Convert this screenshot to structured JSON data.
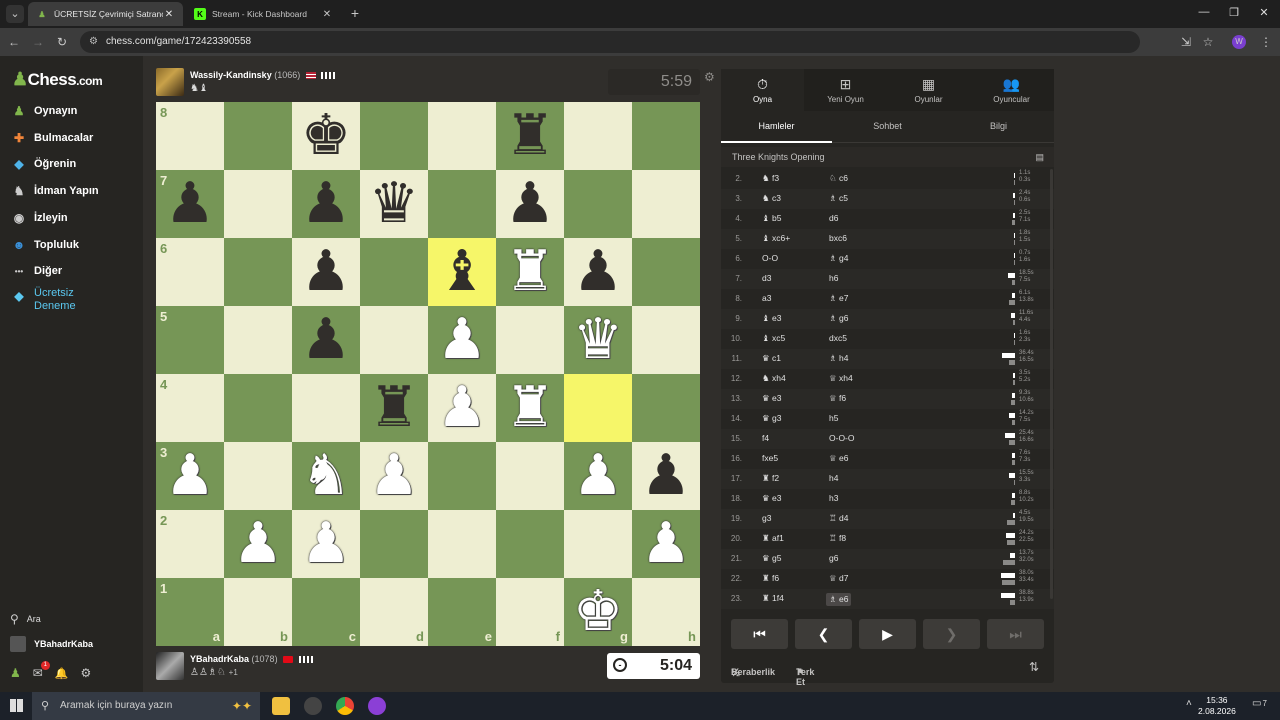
{
  "browser": {
    "tabs": [
      {
        "title": "ÜCRETSİZ Çevrimiçi Satranç Oyu",
        "active": true,
        "icon": "chess-pawn-icon"
      },
      {
        "title": "Stream - Kick Dashboard",
        "active": false,
        "icon": "kick-k-icon"
      }
    ],
    "url": "chess.com/game/172423390558"
  },
  "sidebar": {
    "logo": "Chess",
    "logo_suffix": ".com",
    "items": [
      {
        "label": "Oynayın",
        "icon": "play-pawn-icon",
        "color": "#81b64c"
      },
      {
        "label": "Bulmacalar",
        "icon": "puzzle-icon",
        "color": "#f0853a"
      },
      {
        "label": "Öğrenin",
        "icon": "learn-icon",
        "color": "#4fb3e8"
      },
      {
        "label": "İdman Yapın",
        "icon": "train-icon",
        "color": "#cccccc"
      },
      {
        "label": "İzleyin",
        "icon": "watch-icon",
        "color": "#cccccc"
      },
      {
        "label": "Topluluk",
        "icon": "community-icon",
        "color": "#3a90d8"
      },
      {
        "label": "Diğer",
        "icon": "more-dots-icon",
        "color": "#cccccc"
      },
      {
        "label": "Ücretsiz Deneme",
        "icon": "diamond-icon",
        "color": "#5bc8f0"
      }
    ],
    "search_label": "Ara",
    "username": "YBahadrKaba",
    "notification_count": "1"
  },
  "top_player": {
    "name": "Wassily-Kandinsky",
    "rating": "(1066)",
    "captured": "♞♝",
    "clock": "5:59"
  },
  "bottom_player": {
    "name": "YBahadrKaba",
    "rating": "(1078)",
    "captured": "♙♙♗♘",
    "advantage": "+1",
    "clock": "5:04"
  },
  "board": {
    "files": [
      "a",
      "b",
      "c",
      "d",
      "e",
      "f",
      "g",
      "h"
    ],
    "ranks": [
      "8",
      "7",
      "6",
      "5",
      "4",
      "3",
      "2",
      "1"
    ],
    "highlight": [
      "e6",
      "g4"
    ],
    "pieces": {
      "c8": "bK",
      "f8": "bR",
      "a7": "bP",
      "c7": "bP",
      "d7": "bQ",
      "f7": "bP",
      "c6": "bP",
      "e6": "bB",
      "f6": "wR",
      "g6": "bP",
      "c5": "bP",
      "e5": "wP",
      "g5": "wQ",
      "d4": "bR",
      "e4": "wP",
      "f4": "wR",
      "a3": "wP",
      "c3": "wN",
      "d3": "wP",
      "g3": "wP",
      "h3": "bP",
      "b2": "wP",
      "c2": "wP",
      "h2": "wP",
      "g1": "wK"
    }
  },
  "panel": {
    "tabs": [
      {
        "label": "Oyna",
        "icon": "stopwatch-icon"
      },
      {
        "label": "Yeni Oyun",
        "icon": "plus-icon"
      },
      {
        "label": "Oyunlar",
        "icon": "board-icon"
      },
      {
        "label": "Oyuncular",
        "icon": "players-icon"
      }
    ],
    "subtabs": [
      "Hamleler",
      "Sohbet",
      "Bilgi"
    ],
    "opening": "Three Knights Opening",
    "moves": [
      {
        "n": "2.",
        "w": "♞ f3",
        "b": "♘ c6",
        "wt": "1.1s",
        "bt": "0.3s",
        "wf": 0.1,
        "bf": 0.05
      },
      {
        "n": "3.",
        "w": "♞ c3",
        "b": "♗ c5",
        "wt": "2.4s",
        "bt": "0.6s",
        "wf": 0.12,
        "bf": 0.06
      },
      {
        "n": "4.",
        "w": "♝ b5",
        "b": "d6",
        "wt": "2.5s",
        "bt": "7.1s",
        "wf": 0.12,
        "bf": 0.2
      },
      {
        "n": "5.",
        "w": "♝ xc6+",
        "b": "bxc6",
        "wt": "1.8s",
        "bt": "1.5s",
        "wf": 0.1,
        "bf": 0.08
      },
      {
        "n": "6.",
        "w": "O-O",
        "b": "♗ g4",
        "wt": "0.7s",
        "bt": "1.6s",
        "wf": 0.05,
        "bf": 0.08
      },
      {
        "n": "7.",
        "w": "d3",
        "b": "h6",
        "wt": "18.5s",
        "bt": "7.5s",
        "wf": 0.5,
        "bf": 0.2
      },
      {
        "n": "8.",
        "w": "a3",
        "b": "♗ e7",
        "wt": "6.1s",
        "bt": "13.8s",
        "wf": 0.18,
        "bf": 0.4
      },
      {
        "n": "9.",
        "w": "♝ e3",
        "b": "♗ g6",
        "wt": "11.6s",
        "bt": "4.4s",
        "wf": 0.32,
        "bf": 0.12
      },
      {
        "n": "10.",
        "w": "♝ xc5",
        "b": "dxc5",
        "wt": "1.6s",
        "bt": "2.3s",
        "wf": 0.08,
        "bf": 0.1
      },
      {
        "n": "11.",
        "w": "♛ c1",
        "b": "♗ h4",
        "wt": "36.4s",
        "bt": "16.5s",
        "wf": 0.95,
        "bf": 0.45
      },
      {
        "n": "12.",
        "w": "♞ xh4",
        "b": "♕ xh4",
        "wt": "3.5s",
        "bt": "5.2s",
        "wf": 0.12,
        "bf": 0.15
      },
      {
        "n": "13.",
        "w": "♛ e3",
        "b": "♕ f6",
        "wt": "9.3s",
        "bt": "10.6s",
        "wf": 0.25,
        "bf": 0.3
      },
      {
        "n": "14.",
        "w": "♛ g3",
        "b": "h5",
        "wt": "14.2s",
        "bt": "7.5s",
        "wf": 0.4,
        "bf": 0.2
      },
      {
        "n": "15.",
        "w": "f4",
        "b": "O-O-O",
        "wt": "25.4s",
        "bt": "16.6s",
        "wf": 0.7,
        "bf": 0.45
      },
      {
        "n": "16.",
        "w": "fxe5",
        "b": "♕ e6",
        "wt": "7.6s",
        "bt": "7.3s",
        "wf": 0.2,
        "bf": 0.2
      },
      {
        "n": "17.",
        "w": "♜ f2",
        "b": "h4",
        "wt": "15.5s",
        "bt": "3.3s",
        "wf": 0.42,
        "bf": 0.1
      },
      {
        "n": "18.",
        "w": "♛ e3",
        "b": "h3",
        "wt": "8.8s",
        "bt": "10.2s",
        "wf": 0.24,
        "bf": 0.28
      },
      {
        "n": "19.",
        "w": "g3",
        "b": "♖ d4",
        "wt": "4.5s",
        "bt": "19.5s",
        "wf": 0.13,
        "bf": 0.55
      },
      {
        "n": "20.",
        "w": "♜ af1",
        "b": "♖ f8",
        "wt": "24.2s",
        "bt": "22.5s",
        "wf": 0.65,
        "bf": 0.6
      },
      {
        "n": "21.",
        "w": "♛ g5",
        "b": "g6",
        "wt": "13.7s",
        "bt": "32.0s",
        "wf": 0.38,
        "bf": 0.88
      },
      {
        "n": "22.",
        "w": "♜ f6",
        "b": "♕ d7",
        "wt": "38.0s",
        "bt": "33.4s",
        "wf": 1.0,
        "bf": 0.9
      },
      {
        "n": "23.",
        "w": "♜ 1f4",
        "b": "♗ e6",
        "wt": "38.8s",
        "bt": "13.9s",
        "wf": 1.0,
        "bf": 0.38
      }
    ],
    "draw_label": "Beraberlik",
    "draw_prefix": "½",
    "resign_label": "Terk Et"
  },
  "taskbar": {
    "search_placeholder": "Aramak için buraya yazın",
    "time": "15:36",
    "date": "2.08.2026",
    "notification_count": "7"
  }
}
